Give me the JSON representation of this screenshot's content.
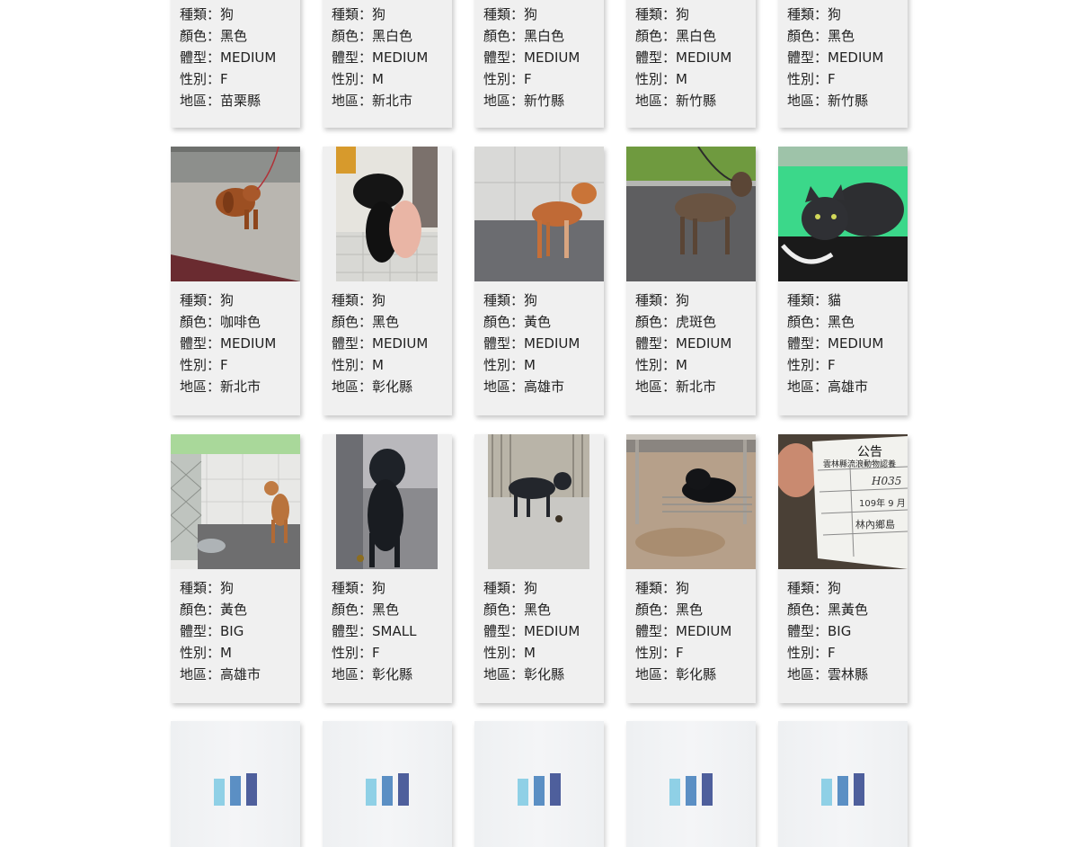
{
  "labels": {
    "species": "種類：",
    "color": "顏色：",
    "size": "體型：",
    "sex": "性別：",
    "region": "地區："
  },
  "rows": [
    [
      {
        "species": "狗",
        "color": "黑色",
        "size": "MEDIUM",
        "sex": "F",
        "region": "苗栗縣"
      },
      {
        "species": "狗",
        "color": "黑白色",
        "size": "MEDIUM",
        "sex": "M",
        "region": "新北市"
      },
      {
        "species": "狗",
        "color": "黑白色",
        "size": "MEDIUM",
        "sex": "F",
        "region": "新竹縣"
      },
      {
        "species": "狗",
        "color": "黑白色",
        "size": "MEDIUM",
        "sex": "M",
        "region": "新竹縣"
      },
      {
        "species": "狗",
        "color": "黑色",
        "size": "MEDIUM",
        "sex": "F",
        "region": "新竹縣"
      }
    ],
    [
      {
        "species": "狗",
        "color": "咖啡色",
        "size": "MEDIUM",
        "sex": "F",
        "region": "新北市"
      },
      {
        "species": "狗",
        "color": "黑色",
        "size": "MEDIUM",
        "sex": "M",
        "region": "彰化縣"
      },
      {
        "species": "狗",
        "color": "黃色",
        "size": "MEDIUM",
        "sex": "M",
        "region": "高雄市"
      },
      {
        "species": "狗",
        "color": "虎斑色",
        "size": "MEDIUM",
        "sex": "M",
        "region": "新北市"
      },
      {
        "species": "貓",
        "color": "黑色",
        "size": "MEDIUM",
        "sex": "F",
        "region": "高雄市"
      }
    ],
    [
      {
        "species": "狗",
        "color": "黃色",
        "size": "BIG",
        "sex": "M",
        "region": "高雄市"
      },
      {
        "species": "狗",
        "color": "黑色",
        "size": "SMALL",
        "sex": "F",
        "region": "彰化縣"
      },
      {
        "species": "狗",
        "color": "黑色",
        "size": "MEDIUM",
        "sex": "M",
        "region": "彰化縣"
      },
      {
        "species": "狗",
        "color": "黑色",
        "size": "MEDIUM",
        "sex": "F",
        "region": "彰化縣"
      },
      {
        "species": "狗",
        "color": "黑黃色",
        "size": "BIG",
        "sex": "F",
        "region": "雲林縣"
      }
    ]
  ],
  "notice": {
    "title": "公告",
    "org": "雲林縣流浪動物認養",
    "id": "H035",
    "date": "109年 9 月",
    "place": "林內鄉島"
  },
  "loader_colors": [
    "#8fd0e6",
    "#5b8fc4",
    "#4e5f9c"
  ]
}
